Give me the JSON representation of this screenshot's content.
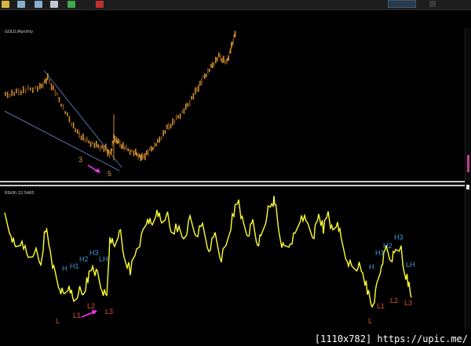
{
  "toolbar": {
    "icons": [
      "toolbar-icon-1",
      "toolbar-icon-2",
      "toolbar-icon-3",
      "toolbar-icon-4",
      "toolbar-icon-5",
      "toolbar-icon-6"
    ]
  },
  "price_panel": {
    "label": "GOLD,Monthly",
    "wave_labels": [
      "3",
      "5"
    ]
  },
  "rsi_panel": {
    "label": "RSI(8) 22.5465",
    "high_labels": [
      "H",
      "H1",
      "H2",
      "H3",
      "LH",
      "H",
      "H1",
      "H2",
      "H3",
      "LH"
    ],
    "low_labels": [
      "L",
      "L1",
      "L2",
      "L3",
      "L",
      "L1",
      "L2",
      "L3"
    ]
  },
  "watermark": "[1110x782] https://upic.me/",
  "colors": {
    "background": "#000000",
    "rsi_line": "#ffff33",
    "high_label": "#3a9ad9",
    "low_label": "#e0502a",
    "arrow": "#ff33ff",
    "wave_label": "#d8a23a",
    "candle": "#d08c2c"
  }
}
